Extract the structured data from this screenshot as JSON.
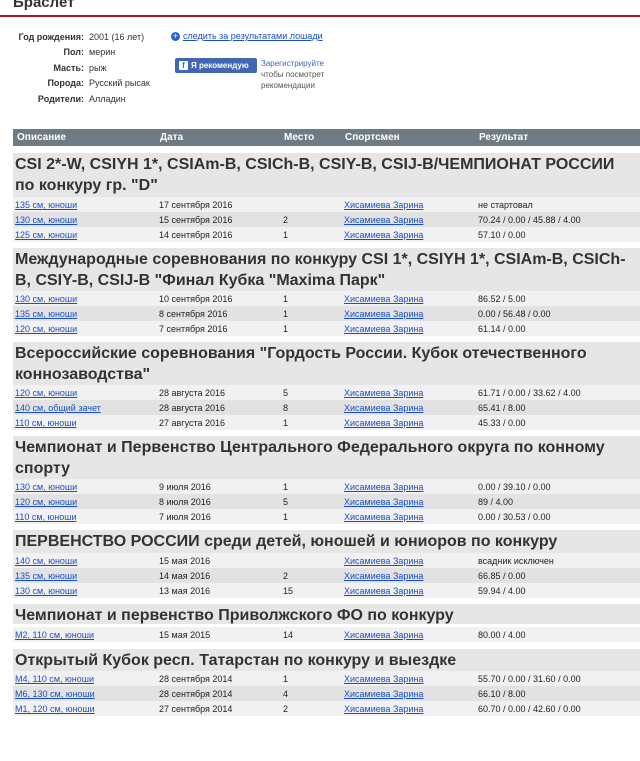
{
  "horse": {
    "name": "Браслет"
  },
  "info": [
    {
      "label": "Год рождения:",
      "value": "2001 (16 лет)"
    },
    {
      "label": "Пол:",
      "value": "мерин"
    },
    {
      "label": "Масть:",
      "value": "рыж"
    },
    {
      "label": "Порода:",
      "value": "Русский рысак"
    },
    {
      "label": "Родители:",
      "value": "Алладин"
    }
  ],
  "follow_link": "следить за результатами лошади",
  "facebook": {
    "button": "Я рекомендую",
    "signup_link": "Зарегистрируйте",
    "note": "чтобы посмотрет рекомендации"
  },
  "columns": [
    "Описание",
    "Дата",
    "Место",
    "Спортсмен",
    "Результат"
  ],
  "sections": [
    {
      "title": "CSI 2*-W, CSIYH 1*, CSIAm-B, CSICh-B, CSIY-B, CSIJ-B/ЧЕМПИОНАТ РОССИИ по конкуру гр. \"D\"",
      "rows": [
        {
          "desc": "135 см, юноши",
          "date": "17 сентября 2016",
          "place": "",
          "rider": "Хисамиева Зарина",
          "result": "не стартовал"
        },
        {
          "desc": "130 см, юноши",
          "date": "15 сентября 2016",
          "place": "2",
          "rider": "Хисамиева Зарина",
          "result": "70.24 / 0.00 / 45.88 / 4.00"
        },
        {
          "desc": "125 см, юноши",
          "date": "14 сентября 2016",
          "place": "1",
          "rider": "Хисамиева Зарина",
          "result": "57.10 / 0.00"
        }
      ]
    },
    {
      "title": "Международные соревнования по конкуру CSI 1*, CSIYH 1*, CSIAm-B, CSICh-B, CSIY-B, CSIJ-B \"Финал Кубка \"Maxima Парк\"",
      "rows": [
        {
          "desc": "130 см, юноши",
          "date": "10 сентября 2016",
          "place": "1",
          "rider": "Хисамиева Зарина",
          "result": "86.52 / 5.00"
        },
        {
          "desc": "135 см, юноши",
          "date": "8 сентября 2016",
          "place": "1",
          "rider": "Хисамиева Зарина",
          "result": "0.00 / 56.48 / 0.00"
        },
        {
          "desc": "120 см, юноши",
          "date": "7 сентября 2016",
          "place": "1",
          "rider": "Хисамиева Зарина",
          "result": "61.14 / 0.00"
        }
      ]
    },
    {
      "title": "Всероссийские соревнования \"Гордость России. Кубок отечественного коннозаводства\"",
      "rows": [
        {
          "desc": "120 см, юноши",
          "date": "28 августа 2016",
          "place": "5",
          "rider": "Хисамиева Зарина",
          "result": "61.71 / 0.00 / 33.62 / 4.00"
        },
        {
          "desc": "140 см, общий зачет",
          "date": "28 августа 2016",
          "place": "8",
          "rider": "Хисамиева Зарина",
          "result": "65.41 / 8.00"
        },
        {
          "desc": "110 см, юноши",
          "date": "27 августа 2016",
          "place": "1",
          "rider": "Хисамиева Зарина",
          "result": "45.33 / 0.00"
        }
      ]
    },
    {
      "title": "Чемпионат и Первенство Центрального Федерального округа по конному спорту",
      "rows": [
        {
          "desc": "130 см, юноши",
          "date": "9 июля 2016",
          "place": "1",
          "rider": "Хисамиева Зарина",
          "result": "0.00 / 39.10 / 0.00"
        },
        {
          "desc": "120 см, юноши",
          "date": "8 июля 2016",
          "place": "5",
          "rider": "Хисамиева Зарина",
          "result": "89 / 4.00"
        },
        {
          "desc": "110 см, юноши",
          "date": "7 июля 2016",
          "place": "1",
          "rider": "Хисамиева Зарина",
          "result": "0.00 / 30.53 / 0.00"
        }
      ]
    },
    {
      "title": "ПЕРВЕНСТВО РОССИИ среди детей, юношей и юниоров по конкуру",
      "rows": [
        {
          "desc": "140 см, юноши",
          "date": "15 мая 2016",
          "place": "",
          "rider": "Хисамиева Зарина",
          "result": "всадник исключен"
        },
        {
          "desc": "135 см, юноши",
          "date": "14 мая 2016",
          "place": "2",
          "rider": "Хисамиева Зарина",
          "result": "66.85 / 0.00"
        },
        {
          "desc": "130 см, юноши",
          "date": "13 мая 2016",
          "place": "15",
          "rider": "Хисамиева Зарина",
          "result": "59.94 / 4.00"
        }
      ]
    },
    {
      "title": "Чемпионат и первенство Приволжского ФО по конкуру",
      "rows": [
        {
          "desc": "М2, 110 см, юноши",
          "date": "15 мая 2015",
          "place": "14",
          "rider": "Хисамиева Зарина",
          "result": "80.00 / 4.00"
        }
      ]
    },
    {
      "title": "Открытый Кубок респ. Татарстан по конкуру и выездке",
      "rows": [
        {
          "desc": "М4, 110 см, юноши",
          "date": "28 сентября 2014",
          "place": "1",
          "rider": "Хисамиева Зарина",
          "result": "55.70 / 0.00 / 31.60 / 0.00"
        },
        {
          "desc": "М6, 130 см, юноши",
          "date": "28 сентября 2014",
          "place": "4",
          "rider": "Хисамиева Зарина",
          "result": "66.10 / 8.00"
        },
        {
          "desc": "М1, 120 см, юноши",
          "date": "27 сентября 2014",
          "place": "2",
          "rider": "Хисамиева Зарина",
          "result": "60.70 / 0.00 / 42.60 / 0.00"
        }
      ]
    }
  ]
}
